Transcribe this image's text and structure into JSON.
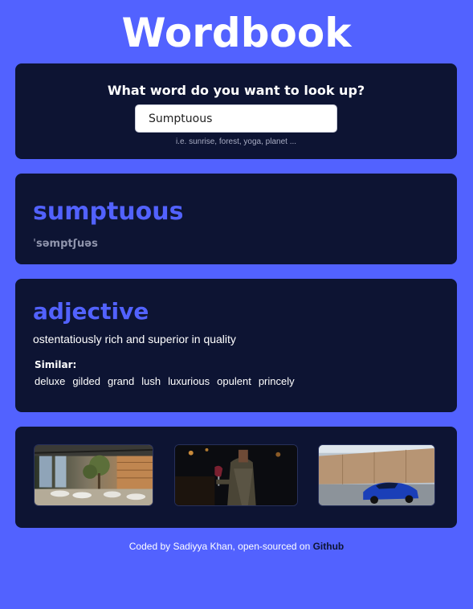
{
  "app": {
    "title": "Wordbook"
  },
  "search": {
    "heading": "What word do you want to look up?",
    "value": "Sumptuous",
    "hint": "i.e. sunrise, forest, yoga, planet ..."
  },
  "word": {
    "text": "sumptuous",
    "phonetic": "ˈsəmptʃuəs"
  },
  "meaning": {
    "part_of_speech": "adjective",
    "definition": "ostentatiously rich and superior in quality",
    "similar_label": "Similar:",
    "synonyms": [
      "deluxe",
      "gilded",
      "grand",
      "lush",
      "luxurious",
      "opulent",
      "princely"
    ]
  },
  "images": [
    {
      "name": "photo-banquet-hall"
    },
    {
      "name": "photo-person-with-wine"
    },
    {
      "name": "photo-blue-sports-car"
    }
  ],
  "footer": {
    "prefix": "Coded by Sadiyya Khan, open-sourced on",
    "link_text": "Github"
  },
  "colors": {
    "background": "#5262ff",
    "card": "#0d1433",
    "accent": "#5262ff"
  }
}
